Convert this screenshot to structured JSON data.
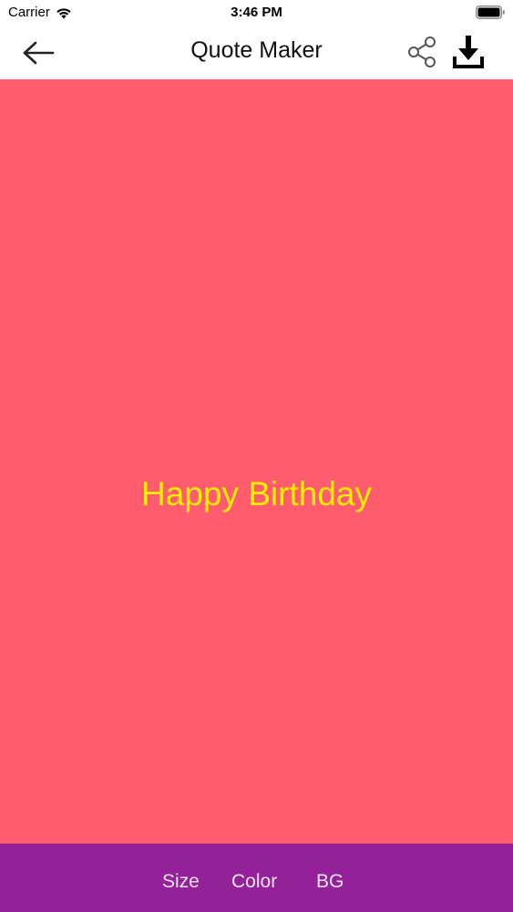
{
  "status_bar": {
    "carrier": "Carrier",
    "time": "3:46 PM"
  },
  "nav": {
    "title": "Quote Maker",
    "icons": [
      "back-arrow-icon",
      "share-icon",
      "download-icon"
    ]
  },
  "canvas": {
    "quote_text": "Happy Birthday",
    "background_color": "#ff5c6e",
    "text_color": "#ffee00"
  },
  "toolbar": {
    "background_color": "#95219a",
    "size_label": "Size",
    "color_label": "Color",
    "bg_label": "BG"
  }
}
